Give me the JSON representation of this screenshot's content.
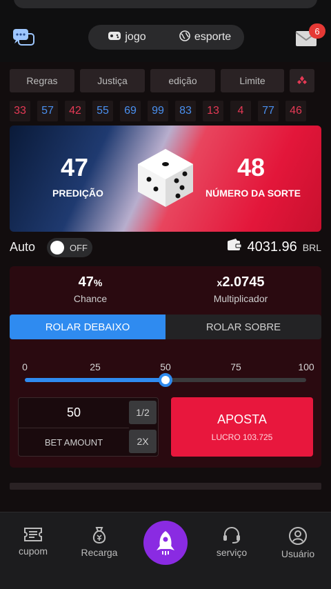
{
  "header": {
    "modes": [
      {
        "label": "jogo",
        "icon": "gamepad-icon"
      },
      {
        "label": "esporte",
        "icon": "globe-icon"
      }
    ],
    "mail_badge": "6"
  },
  "tabs": [
    "Regras",
    "Justiça",
    "edição",
    "Limite"
  ],
  "history": [
    {
      "value": "33",
      "color": "red"
    },
    {
      "value": "57",
      "color": "blue"
    },
    {
      "value": "42",
      "color": "red"
    },
    {
      "value": "55",
      "color": "blue"
    },
    {
      "value": "69",
      "color": "blue"
    },
    {
      "value": "99",
      "color": "blue"
    },
    {
      "value": "83",
      "color": "blue"
    },
    {
      "value": "13",
      "color": "red"
    },
    {
      "value": "4",
      "color": "red"
    },
    {
      "value": "77",
      "color": "blue"
    },
    {
      "value": "46",
      "color": "red"
    }
  ],
  "banner": {
    "prediction_value": "47",
    "prediction_label": "PREDIÇÃO",
    "lucky_value": "48",
    "lucky_label": "NÚMERO DA SORTE"
  },
  "auto": {
    "label": "Auto",
    "state": "OFF"
  },
  "wallet": {
    "amount": "4031.96",
    "currency": "BRL"
  },
  "stats": {
    "chance_value": "47",
    "chance_unit": "%",
    "chance_label": "Chance",
    "mult_prefix": "x",
    "mult_value": "2.0745",
    "mult_label": "Multiplicador"
  },
  "roll": {
    "under": "ROLAR DEBAIXO",
    "over": "ROLAR SOBRE",
    "active": "under"
  },
  "slider": {
    "ticks": [
      "0",
      "25",
      "50",
      "75",
      "100"
    ],
    "value": 50
  },
  "bet": {
    "amount": "50",
    "label": "BET AMOUNT",
    "half": "1/2",
    "double": "2X",
    "button": "APOSTA",
    "profit": "LUCRO 103.725"
  },
  "nav": [
    {
      "label": "cupom",
      "icon": "coupon-icon"
    },
    {
      "label": "Recarga",
      "icon": "money-bag-icon"
    },
    {
      "label": "",
      "icon": "rocket-icon"
    },
    {
      "label": "serviço",
      "icon": "headset-icon"
    },
    {
      "label": "Usuário",
      "icon": "user-icon"
    }
  ],
  "colors": {
    "accent_blue": "#2f8bf0",
    "accent_red": "#e8173d",
    "center_purple": "#8a2be2"
  }
}
